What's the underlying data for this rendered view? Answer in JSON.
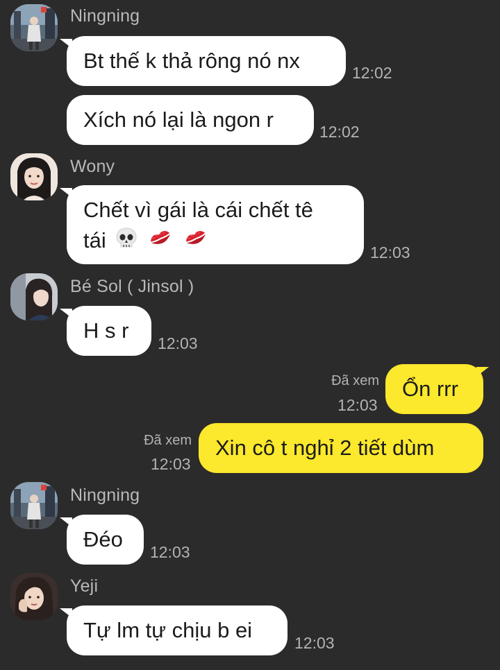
{
  "messages": [
    {
      "sender": "Ningning",
      "text": "Bt thế k thả rông nó nx",
      "time": "12:02"
    },
    {
      "text": "Xích nó lại là ngon r",
      "time": "12:02"
    },
    {
      "sender": "Wony",
      "line1": "Chết vì gái là cái chết tê",
      "line2": "tái",
      "emojis": [
        "skull-icon",
        "kiss-mark-icon",
        "kiss-mark-icon"
      ],
      "time": "12:03"
    },
    {
      "sender": "Bé Sol ( Jinsol )",
      "text": "H s r",
      "time": "12:03"
    },
    {
      "me": true,
      "text": "Ổn rrr",
      "status": "Đã xem",
      "time": "12:03"
    },
    {
      "me": true,
      "text": "Xin cô t nghỉ 2 tiết dùm",
      "status": "Đã xem",
      "time": "12:03"
    },
    {
      "sender": "Ningning",
      "text": "Đéo",
      "time": "12:03"
    },
    {
      "sender": "Yeji",
      "text": "Tự lm tự chịu b ei",
      "time": "12:03"
    }
  ],
  "colors": {
    "background": "#2b2b2b",
    "incoming_bubble": "#ffffff",
    "outgoing_bubble": "#fce82c",
    "meta_text": "#b3b3b3"
  }
}
